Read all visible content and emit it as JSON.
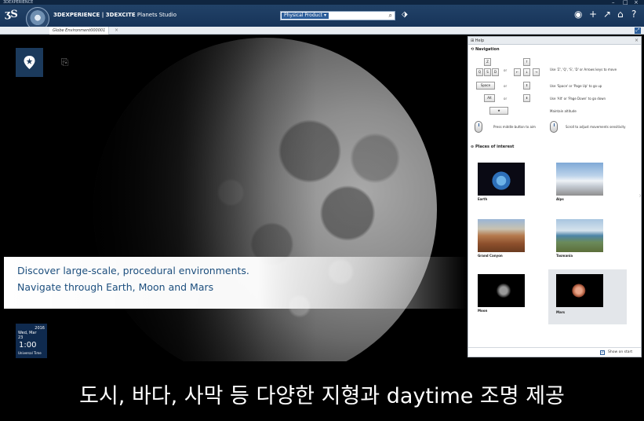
{
  "window": {
    "title": "3DEXPERIENCE",
    "controls": [
      "–",
      "□",
      "×"
    ]
  },
  "topbar": {
    "brand": "3DEXPERIENCE | 3DEXCITE",
    "app_name": "Planets Studio",
    "search_scope": "Physical Product ▾",
    "search_placeholder": "",
    "icons": [
      "user-icon",
      "add-icon",
      "share-icon",
      "home-icon",
      "help-icon"
    ]
  },
  "tab": {
    "label": "Globe Environment000001",
    "close": "×"
  },
  "banner": {
    "line1": "Discover large-scale, procedural environments.",
    "line2": "Navigate through Earth, Moon and Mars"
  },
  "clock": {
    "year": "2016",
    "date": "Wed, Mar 23",
    "time": "1:00",
    "timezone": "Universal Time"
  },
  "help": {
    "title": "Help",
    "navigation_title": "Navigation",
    "keys_move": [
      "Z",
      "Q",
      "S",
      "D"
    ],
    "arrow_keys": [
      "↑",
      "←",
      "↓",
      "→"
    ],
    "instr_move": "Use 'Z', 'Q', 'S', 'D' or Arrows keys to move",
    "key_space": "Space",
    "key_pageup": "⇞",
    "instr_up": "Use 'Space' or 'Page Up' to go up",
    "key_alt": "Alt",
    "key_pagedown": "⇟",
    "instr_down": "Use 'Alt' or 'Page Down' to go down",
    "key_star": "★",
    "instr_altitude": "Maintain altitude",
    "instr_aim": "Press middle button to aim",
    "instr_scroll": "Scroll to adjust movements sensitivity",
    "or_label": "or",
    "places_title": "Places of interest",
    "places": [
      {
        "name": "Earth"
      },
      {
        "name": "Alps"
      },
      {
        "name": "Grand Canyon"
      },
      {
        "name": "Tasmania"
      },
      {
        "name": "Moon"
      },
      {
        "name": "Mars"
      }
    ],
    "show_on_start": "Show on start",
    "show_checked": true
  },
  "subtitle": "도시, 바다, 사막 등 다양한 지형과 daytime 조명 제공",
  "colors": {
    "header_blue": "#173459",
    "banner_text": "#1d4f7e",
    "accent": "#2b5d9a"
  }
}
